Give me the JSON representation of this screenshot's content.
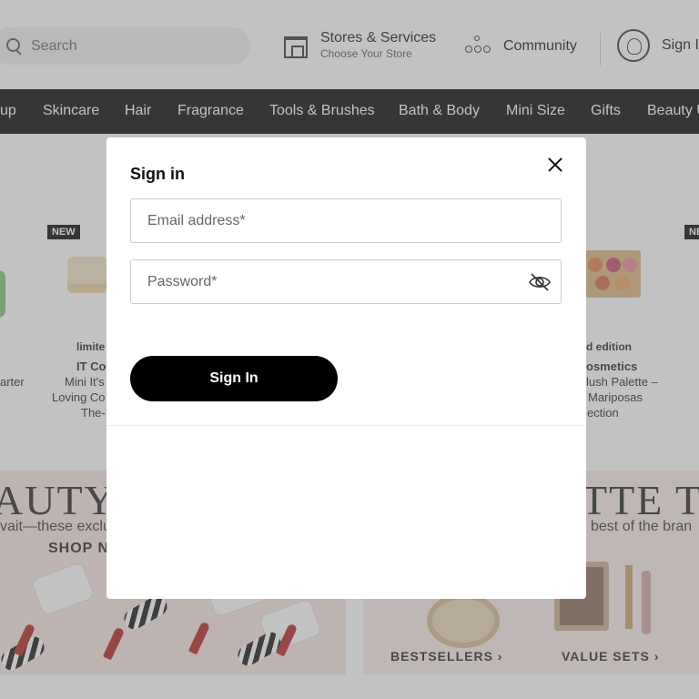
{
  "header": {
    "search_placeholder": "Search",
    "stores_title": "Stores & Services",
    "stores_sub": "Choose Your Store",
    "community_label": "Community",
    "signin_label": "Sign I"
  },
  "nav": {
    "items": [
      "up",
      "Skincare",
      "Hair",
      "Fragrance",
      "Tools & Brushes",
      "Bath & Body",
      "Mini Size",
      "Gifts",
      "Beauty U"
    ]
  },
  "products": {
    "badge_left": "NEW",
    "badge_right": "NE",
    "left_line1": "arter",
    "mid_line1": "limite",
    "mid_line2": "IT Co",
    "mid_line3": "Mini It's",
    "mid_line4": "Loving Co",
    "mid_line5": "The-",
    "right_line1": "d edition",
    "right_line2": "osmetics",
    "right_line3": "lush Palette –",
    "right_line4": "Mariposas",
    "right_line5": "ection"
  },
  "banners": {
    "left_big": "AUTY",
    "left_sub": "vait—these exclu",
    "left_cta": "SHOP N",
    "right_big": "TTE TIL",
    "right_sub": "best of the bran",
    "cta_bestsellers": "BESTSELLERS ›",
    "cta_value_sets": "VALUE SETS ›"
  },
  "modal": {
    "title": "Sign in",
    "email_placeholder": "Email address*",
    "password_placeholder": "Password*",
    "signin_button": "Sign In"
  }
}
